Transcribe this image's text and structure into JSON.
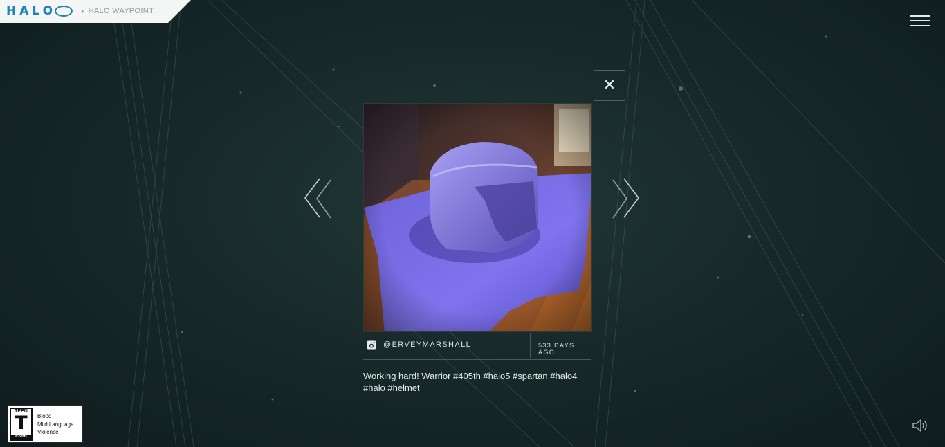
{
  "brand": {
    "logo_text": "HALO",
    "breadcrumb": "HALO WAYPOINT"
  },
  "header": {
    "menu_icon": "hamburger-menu-icon"
  },
  "viewer": {
    "close_icon": "close-icon",
    "prev_icon": "chevron-left-icon",
    "next_icon": "chevron-right-icon",
    "photo_alt": "Paper craft Halo helmet on blue paper",
    "source_icon": "instagram-icon",
    "handle": "@ERVEYMARSHALL",
    "time_ago": "533 DAYS AGO",
    "caption": "Working hard! Warrior #405th #halo5 #spartan #halo4 #halo #helmet"
  },
  "rating": {
    "badge_top": "TEEN",
    "badge_letter": "T",
    "badge_bottom": "ESRB",
    "descriptors": [
      "Blood",
      "Mild Language",
      "Violence"
    ]
  },
  "footer": {
    "sound_icon": "speaker-icon"
  },
  "colors": {
    "background": "#18292a",
    "brand_blue": "#1f82b8",
    "text": "#e6ecec",
    "divider": "#4a5856"
  }
}
